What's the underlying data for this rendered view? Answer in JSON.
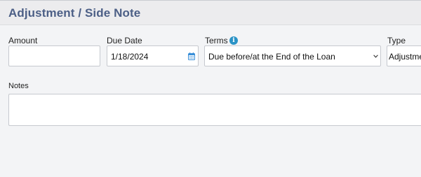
{
  "header": {
    "title": "Adjustment / Side Note"
  },
  "form": {
    "amount": {
      "label": "Amount",
      "value": ""
    },
    "due_date": {
      "label": "Due Date",
      "value": "1/18/2024",
      "icon": "calendar-icon"
    },
    "terms": {
      "label": "Terms",
      "info_icon": "i",
      "value": "Due before/at the End of the Loan",
      "icon": "chevron-down-icon"
    },
    "type": {
      "label": "Type",
      "value": "Adjustme"
    },
    "notes": {
      "label": "Notes",
      "value": ""
    }
  },
  "colors": {
    "title": "#4c5f86",
    "info": "#2b93c6",
    "calendar": "#3a8fd8"
  }
}
